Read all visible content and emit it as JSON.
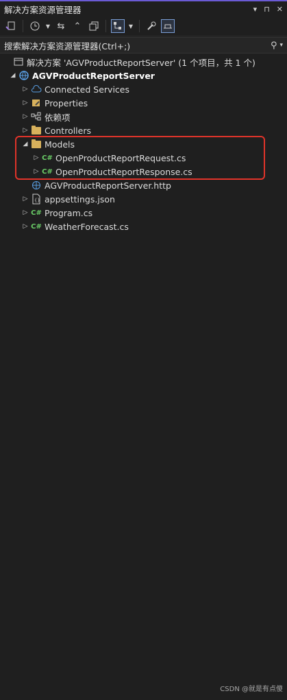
{
  "window": {
    "title": "解决方案资源管理器",
    "controls": [
      "▾",
      "⊓",
      "✕"
    ]
  },
  "toolbar": {
    "icons": [
      "solution-switch-icon",
      "history-icon",
      "dropdown-icon",
      "sync-icon",
      "collapse-all-icon",
      "show-all-files-icon",
      "view-toggle-icon",
      "dropdown-icon",
      "properties-wrench-icon",
      "preview-icon"
    ]
  },
  "search": {
    "placeholder": "搜索解决方案资源管理器(Ctrl+;)",
    "icon": "search-icon"
  },
  "tree": {
    "solution": "解决方案 'AGVProductReportServer' (1 个项目，共 1 个)",
    "project": "AGVProductReportServer",
    "items": [
      {
        "label": "Connected Services",
        "icon": "connected-services-icon"
      },
      {
        "label": "Properties",
        "icon": "properties-icon"
      },
      {
        "label": "依赖项",
        "icon": "dependencies-icon"
      },
      {
        "label": "Controllers",
        "icon": "folder-icon"
      },
      {
        "label": "Models",
        "icon": "folder-icon"
      },
      {
        "label": "OpenProductReportRequest.cs",
        "icon": "csharp-file-icon"
      },
      {
        "label": "OpenProductReportResponse.cs",
        "icon": "csharp-file-icon"
      },
      {
        "label": "AGVProductReportServer.http",
        "icon": "http-file-icon"
      },
      {
        "label": "appsettings.json",
        "icon": "json-file-icon"
      },
      {
        "label": "Program.cs",
        "icon": "csharp-file-icon"
      },
      {
        "label": "WeatherForecast.cs",
        "icon": "csharp-file-icon"
      }
    ]
  },
  "watermark": "CSDN @就是有点傻",
  "colors": {
    "background": "#1f1f1f",
    "highlight_border": "#e2342a",
    "csharp": "#6acd67",
    "folder": "#d8b15c"
  }
}
